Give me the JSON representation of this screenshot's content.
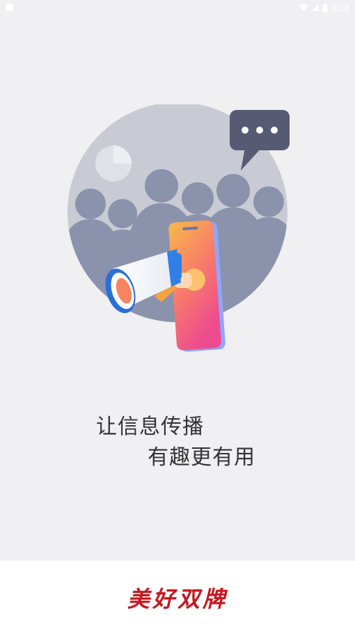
{
  "status_bar": {
    "time": "3:18",
    "icons": [
      "notification-icon",
      "wifi-icon",
      "signal-icon",
      "battery-icon"
    ]
  },
  "splash": {
    "slogan_line1": "让信息传播",
    "slogan_line2": "有趣更有用",
    "illustration": "megaphone-phone-crowd-illustration"
  },
  "footer": {
    "brand": "美好双牌"
  },
  "colors": {
    "background": "#f0eff1",
    "brand_red": "#c8161d",
    "slogan_text": "#333333"
  }
}
